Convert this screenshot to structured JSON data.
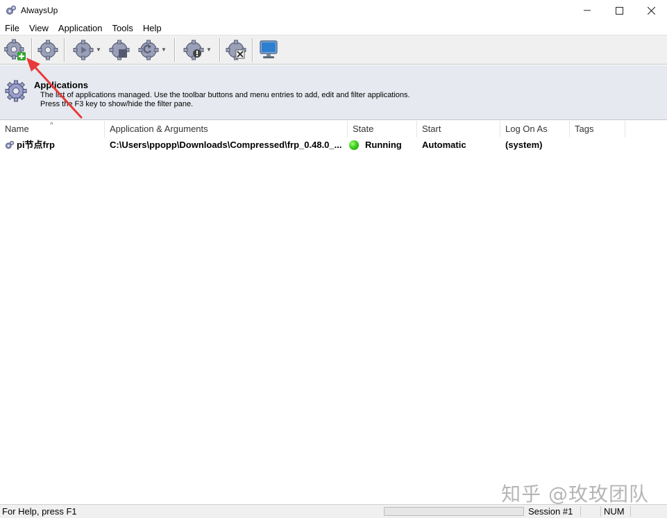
{
  "window": {
    "title": "AlwaysUp",
    "app_icon": "gears-icon",
    "controls": {
      "minimize": "minimize-icon",
      "maximize": "maximize-icon",
      "close": "close-icon"
    }
  },
  "menu": {
    "items": [
      "File",
      "View",
      "Application",
      "Tools",
      "Help"
    ]
  },
  "toolbar": {
    "buttons": [
      {
        "icon": "add-application-icon"
      },
      {
        "icon": "edit-application-icon"
      },
      {
        "icon": "start-application-icon"
      },
      {
        "icon": "stop-application-icon"
      },
      {
        "icon": "restart-application-icon"
      },
      {
        "icon": "report-icon"
      },
      {
        "icon": "delete-application-icon"
      },
      {
        "icon": "console-icon"
      }
    ]
  },
  "header": {
    "title": "Applications",
    "line1": "The list of applications managed. Use the toolbar buttons and menu entries to add, edit and filter applications.",
    "line2": "Press the F3 key to show/hide the filter pane."
  },
  "table": {
    "columns": [
      "Name",
      "Application & Arguments",
      "State",
      "Start",
      "Log On As",
      "Tags"
    ],
    "rows": [
      {
        "name": "pi节点frp",
        "app_args": "C:\\Users\\ppopp\\Downloads\\Compressed\\frp_0.48.0_...",
        "state": "Running",
        "start": "Automatic",
        "logon": "(system)",
        "tags": ""
      }
    ]
  },
  "status": {
    "help": "For Help, press F1",
    "session": "Session #1",
    "num": "NUM"
  },
  "watermark": "知乎 @玫玫团队",
  "colors": {
    "running": "#3fcf1e",
    "annotation_arrow": "#e83a3a",
    "header_bg": "#e6e9ef"
  }
}
